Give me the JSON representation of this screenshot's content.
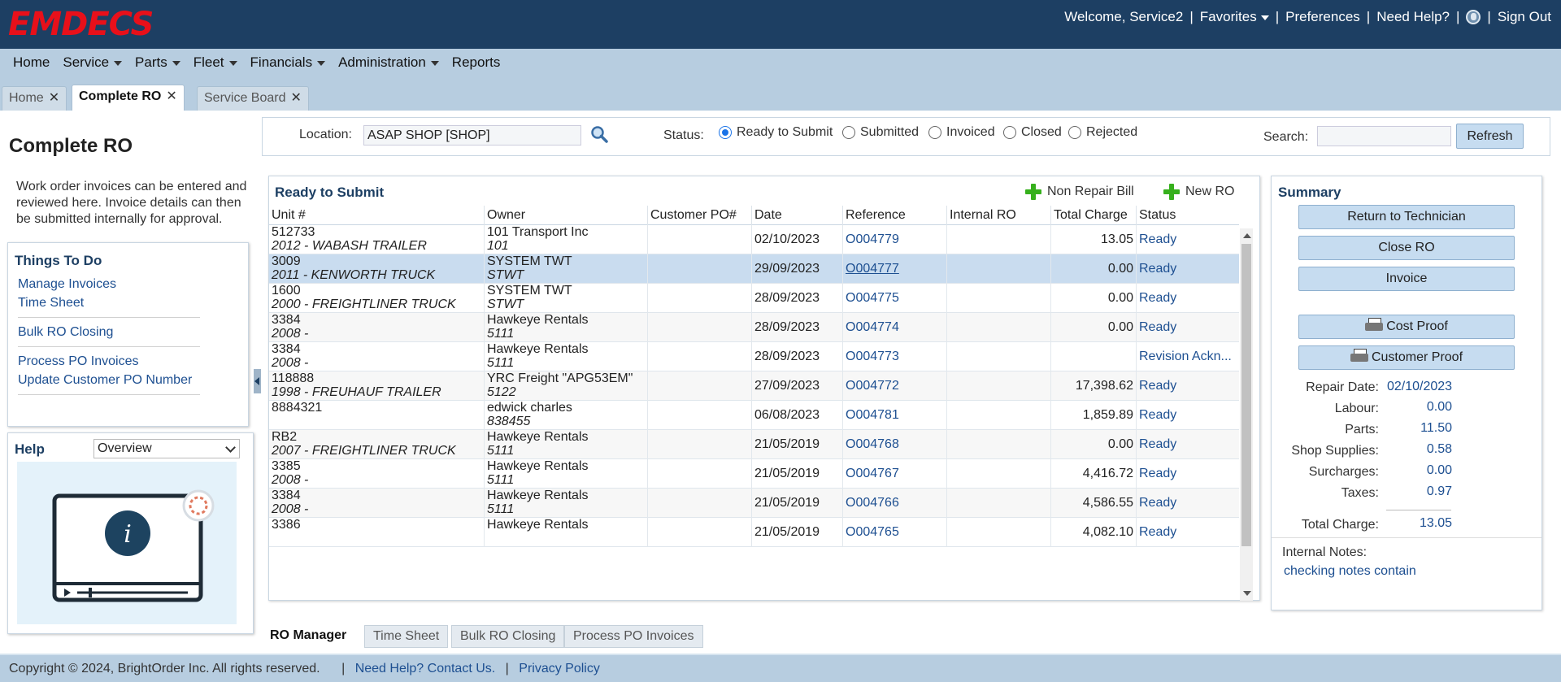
{
  "app": {
    "logo": "EMDECS"
  },
  "topnav": {
    "welcome": "Welcome, Service2",
    "favorites": "Favorites",
    "preferences": "Preferences",
    "help": "Need Help?",
    "signout": "Sign Out"
  },
  "menu": [
    "Home",
    "Service",
    "Parts",
    "Fleet",
    "Financials",
    "Administration",
    "Reports"
  ],
  "tabs": [
    "Home",
    "Complete RO",
    "Service Board"
  ],
  "page": {
    "title": "Complete RO",
    "description": "Work order invoices can be entered and reviewed here. Invoice details can then be submitted internally for approval."
  },
  "todo": {
    "title": "Things To Do",
    "items": [
      "Manage Invoices",
      "Time Sheet",
      "Bulk RO Closing",
      "Process PO Invoices",
      "Update Customer PO Number"
    ]
  },
  "help": {
    "title": "Help",
    "selected": "Overview"
  },
  "filter": {
    "location_label": "Location:",
    "location_value": "ASAP SHOP [SHOP]",
    "status_label": "Status:",
    "statuses": [
      "Ready to Submit",
      "Submitted",
      "Invoiced",
      "Closed",
      "Rejected"
    ],
    "selected_status": "Ready to Submit",
    "search_label": "Search:",
    "refresh": "Refresh"
  },
  "grid": {
    "title": "Ready to Submit",
    "non_repair_bill": "Non Repair Bill",
    "new_ro": "New RO",
    "columns": [
      "Unit #",
      "Owner",
      "Customer PO#",
      "Date",
      "Reference",
      "Internal RO",
      "Total Charge",
      "Status"
    ],
    "rows": [
      {
        "unit": "512733",
        "unit_desc": "2012 - WABASH TRAILER",
        "owner": "101 Transport Inc",
        "owner_code": "101",
        "po": "",
        "date": "02/10/2023",
        "ref": "O004779",
        "internal": "",
        "total": "13.05",
        "status": "Ready"
      },
      {
        "unit": "3009",
        "unit_desc": "2011 - KENWORTH TRUCK",
        "owner": "SYSTEM TWT",
        "owner_code": "STWT",
        "po": "",
        "date": "29/09/2023",
        "ref": "O004777",
        "internal": "",
        "total": "0.00",
        "status": "Ready"
      },
      {
        "unit": "1600",
        "unit_desc": "2000 - FREIGHTLINER TRUCK",
        "owner": "SYSTEM TWT",
        "owner_code": "STWT",
        "po": "",
        "date": "28/09/2023",
        "ref": "O004775",
        "internal": "",
        "total": "0.00",
        "status": "Ready"
      },
      {
        "unit": "3384",
        "unit_desc": "2008 -",
        "owner": "Hawkeye Rentals",
        "owner_code": "5111",
        "po": "",
        "date": "28/09/2023",
        "ref": "O004774",
        "internal": "",
        "total": "0.00",
        "status": "Ready"
      },
      {
        "unit": "3384",
        "unit_desc": "2008 -",
        "owner": "Hawkeye Rentals",
        "owner_code": "5111",
        "po": "",
        "date": "28/09/2023",
        "ref": "O004773",
        "internal": "",
        "total": "",
        "status": "Revision Ackn..."
      },
      {
        "unit": "118888",
        "unit_desc": "1998 - FREUHAUF TRAILER",
        "owner": "YRC Freight \"APG53EM\"",
        "owner_code": "5122",
        "po": "",
        "date": "27/09/2023",
        "ref": "O004772",
        "internal": "",
        "total": "17,398.62",
        "status": "Ready"
      },
      {
        "unit": "8884321",
        "unit_desc": "",
        "owner": "edwick charles",
        "owner_code": "838455",
        "po": "",
        "date": "06/08/2023",
        "ref": "O004781",
        "internal": "",
        "total": "1,859.89",
        "status": "Ready"
      },
      {
        "unit": "RB2",
        "unit_desc": "2007 - FREIGHTLINER TRUCK",
        "owner": "Hawkeye Rentals",
        "owner_code": "5111",
        "po": "",
        "date": "21/05/2019",
        "ref": "O004768",
        "internal": "",
        "total": "0.00",
        "status": "Ready"
      },
      {
        "unit": "3385",
        "unit_desc": "2008 -",
        "owner": "Hawkeye Rentals",
        "owner_code": "5111",
        "po": "",
        "date": "21/05/2019",
        "ref": "O004767",
        "internal": "",
        "total": "4,416.72",
        "status": "Ready"
      },
      {
        "unit": "3384",
        "unit_desc": "2008 -",
        "owner": "Hawkeye Rentals",
        "owner_code": "5111",
        "po": "",
        "date": "21/05/2019",
        "ref": "O004766",
        "internal": "",
        "total": "4,586.55",
        "status": "Ready"
      },
      {
        "unit": "3386",
        "unit_desc": "",
        "owner": "Hawkeye Rentals",
        "owner_code": "",
        "po": "",
        "date": "21/05/2019",
        "ref": "O004765",
        "internal": "",
        "total": "4,082.10",
        "status": "Ready"
      }
    ]
  },
  "bottom_tabs": [
    "RO Manager",
    "Time Sheet",
    "Bulk RO Closing",
    "Process PO Invoices"
  ],
  "summary": {
    "title": "Summary",
    "buttons": {
      "return": "Return to Technician",
      "close": "Close RO",
      "invoice": "Invoice",
      "cost_proof": "Cost Proof",
      "customer_proof": "Customer Proof"
    },
    "repair_date_label": "Repair Date:",
    "repair_date": "02/10/2023",
    "lines": [
      {
        "label": "Labour:",
        "value": "0.00"
      },
      {
        "label": "Parts:",
        "value": "11.50"
      },
      {
        "label": "Shop Supplies:",
        "value": "0.58"
      },
      {
        "label": "Surcharges:",
        "value": "0.00"
      },
      {
        "label": "Taxes:",
        "value": "0.97"
      }
    ],
    "total_label": "Total Charge:",
    "total": "13.05",
    "notes_label": "Internal Notes:",
    "notes": "checking notes contain"
  },
  "footer": {
    "copyright": "Copyright © 2024, BrightOrder Inc. All rights reserved.",
    "contact": "Need Help? Contact Us.",
    "privacy": "Privacy Policy"
  },
  "colors": {
    "header": "#1d3f63",
    "accent": "#e8101a",
    "link": "#1d4f91",
    "selected_row": "#c9dcef"
  }
}
